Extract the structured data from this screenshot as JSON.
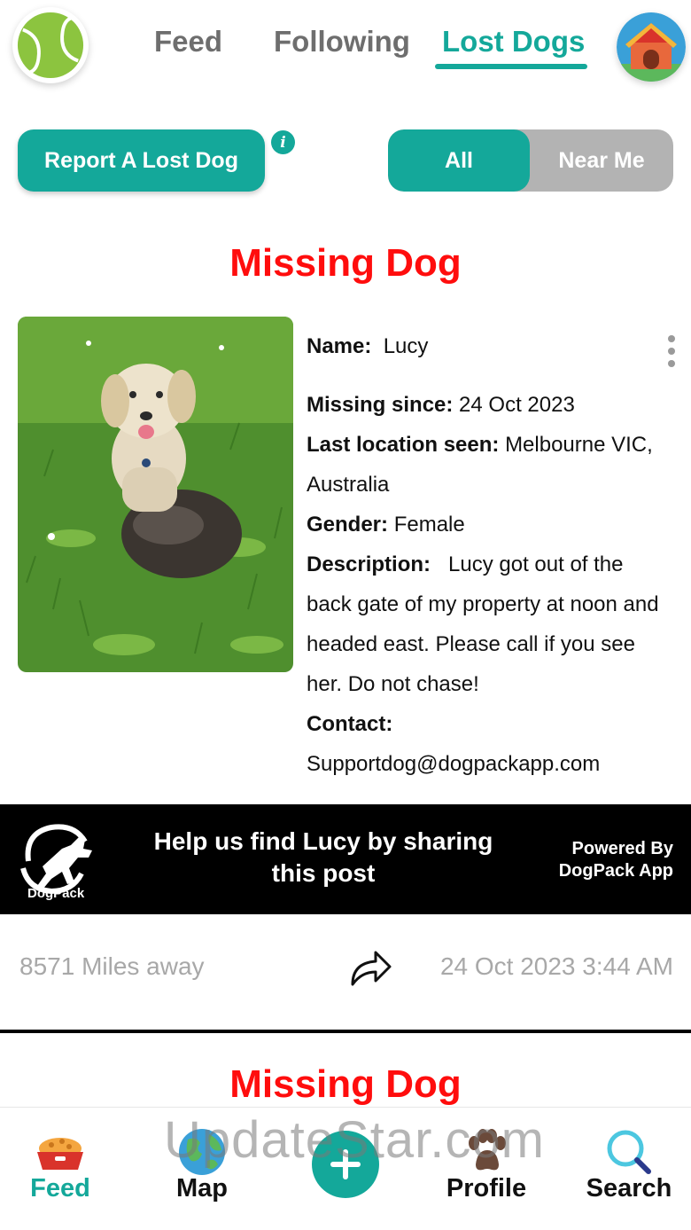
{
  "header": {
    "tabs": [
      {
        "label": "Feed"
      },
      {
        "label": "Following"
      },
      {
        "label": "Lost Dogs",
        "active": true
      }
    ],
    "logo_icon": "tennis-ball-icon",
    "avatar_icon": "dog-house-icon"
  },
  "actions": {
    "report_label": "Report A Lost Dog",
    "info_icon_glyph": "i",
    "filter": {
      "all_label": "All",
      "near_label": "Near Me",
      "selected": "All"
    }
  },
  "post": {
    "title": "Missing Dog",
    "photo_icon": "dog-photo",
    "details": {
      "name_label": "Name:",
      "name_value": "Lucy",
      "since_label": "Missing since:",
      "since_value": "24 Oct 2023",
      "location_label": "Last location seen:",
      "location_value": "Melbourne VIC, Australia",
      "gender_label": "Gender:",
      "gender_value": "Female",
      "description_label": "Description:",
      "description_value": "Lucy got out of the back gate of my property at noon and headed east. Please call if you see her. Do not chase!",
      "contact_label": "Contact:",
      "contact_value": "Supportdog@dogpackapp.com"
    },
    "banner": {
      "logo_text": "DogPack",
      "message_line1": "Help us find Lucy by sharing",
      "message_line2": "this post",
      "powered_line1": "Powered By",
      "powered_line2": "DogPack App"
    },
    "distance": "8571 Miles away",
    "timestamp": "24 Oct 2023 3:44 AM"
  },
  "next_post": {
    "title": "Missing Dog"
  },
  "bottom_nav": {
    "items": [
      {
        "label": "Feed",
        "icon": "food-bowl-icon",
        "active": true
      },
      {
        "label": "Map",
        "icon": "globe-icon"
      },
      {
        "label": "Profile",
        "icon": "paw-icon"
      },
      {
        "label": "Search",
        "icon": "search-icon"
      }
    ],
    "add_icon": "plus-icon"
  },
  "watermark": "UpdateStar.com",
  "colors": {
    "accent": "#14a89a",
    "alert_red": "#ff0d0d",
    "muted_gray": "#a8a8a8",
    "toggle_gray": "#b3b3b3"
  }
}
